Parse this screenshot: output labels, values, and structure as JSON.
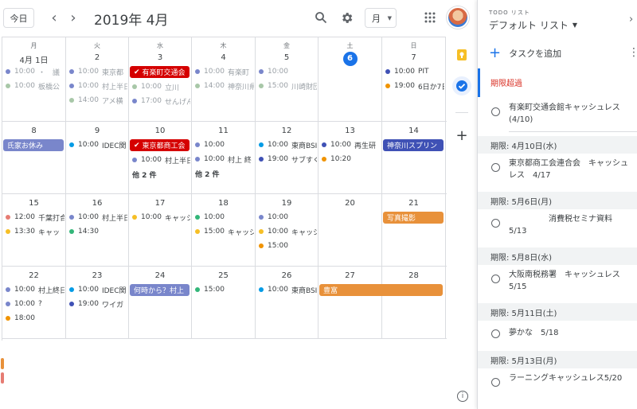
{
  "header": {
    "today_label": "今日",
    "prev_label": "‹",
    "next_label": "›",
    "month_title": "2019年 4月",
    "view_label": "月",
    "search_icon": "search-icon",
    "settings_icon": "gear-icon",
    "apps_icon": "apps-grid-icon"
  },
  "weekdays": [
    "月",
    "火",
    "水",
    "木",
    "金",
    "土",
    "日"
  ],
  "weeks": [
    {
      "days": [
        {
          "label": "4月 1日",
          "today": false,
          "events": [
            {
              "type": "dot",
              "time": "10:00",
              "title": "・　議",
              "color": "#7986cb",
              "past": true
            },
            {
              "type": "dot",
              "time": "10:00",
              "title": "板橋公",
              "color": "#a8c7a8",
              "past": true
            }
          ]
        },
        {
          "label": "2",
          "today": false,
          "events": [
            {
              "type": "dot",
              "time": "10:00",
              "title": "東京都",
              "color": "#7986cb",
              "past": true
            },
            {
              "type": "dot",
              "time": "10:00",
              "title": "村上半日",
              "color": "#7986cb",
              "past": true
            },
            {
              "type": "dot",
              "time": "14:00",
              "title": "アメ横",
              "color": "#a8c7a8",
              "past": true
            }
          ]
        },
        {
          "label": "3",
          "today": false,
          "events": [
            {
              "type": "bar",
              "title": "有楽町交通会",
              "color": "#d50000",
              "check": true
            },
            {
              "type": "dot",
              "time": "10:00",
              "title": "立川",
              "color": "#a8c7a8",
              "past": true
            },
            {
              "type": "dot",
              "time": "17:00",
              "title": "せんげん",
              "color": "#7986cb",
              "past": true
            }
          ]
        },
        {
          "label": "4",
          "today": false,
          "events": [
            {
              "type": "dot",
              "time": "10:00",
              "title": "有楽町",
              "color": "#7986cb",
              "past": true
            },
            {
              "type": "dot",
              "time": "14:00",
              "title": "神奈川県",
              "color": "#a8c7a8",
              "past": true
            }
          ]
        },
        {
          "label": "5",
          "today": false,
          "events": [
            {
              "type": "dot",
              "time": "10:00",
              "title": "",
              "color": "#7986cb",
              "past": true
            },
            {
              "type": "dot",
              "time": "15:00",
              "title": "川崎財団",
              "color": "#a8c7a8",
              "past": true
            }
          ]
        },
        {
          "label": "6",
          "today": true,
          "events": []
        },
        {
          "label": "7",
          "today": false,
          "events": [
            {
              "type": "dot",
              "time": "10:00",
              "title": "PIT",
              "color": "#3f51b5",
              "past": false
            },
            {
              "type": "dot",
              "time": "19:00",
              "title": "6日か7日",
              "color": "#f09300",
              "past": false
            }
          ]
        }
      ],
      "spans": []
    },
    {
      "days": [
        {
          "label": "8",
          "today": false,
          "events": [
            {
              "type": "bar",
              "title": "氏家お休み",
              "color": "#7986cb"
            }
          ]
        },
        {
          "label": "9",
          "today": false,
          "events": [
            {
              "type": "dot",
              "time": "10:00",
              "title": "IDEC関",
              "color": "#039be5",
              "past": false
            }
          ]
        },
        {
          "label": "10",
          "today": false,
          "events": [
            {
              "type": "bar",
              "title": "東京都商工会",
              "color": "#d50000",
              "check": true
            },
            {
              "type": "dot",
              "time": "10:00",
              "title": "村上半日",
              "color": "#7986cb",
              "past": false
            },
            {
              "type": "more",
              "title": "他 2 件"
            }
          ]
        },
        {
          "label": "11",
          "today": false,
          "events": [
            {
              "type": "dot",
              "time": "10:00",
              "title": "",
              "color": "#7986cb",
              "past": false
            },
            {
              "type": "dot",
              "time": "10:00",
              "title": "村上 終",
              "color": "#7986cb",
              "past": false
            },
            {
              "type": "more",
              "title": "他 2 件"
            }
          ]
        },
        {
          "label": "12",
          "today": false,
          "events": [
            {
              "type": "dot",
              "time": "10:00",
              "title": "東商BSI",
              "color": "#039be5",
              "past": false
            },
            {
              "type": "dot",
              "time": "19:00",
              "title": "サブすく",
              "color": "#3f51b5",
              "past": false
            }
          ]
        },
        {
          "label": "13",
          "today": false,
          "events": [
            {
              "type": "dot",
              "time": "10:00",
              "title": "再生研",
              "color": "#3f51b5",
              "past": false
            },
            {
              "type": "dot",
              "time": "10:20",
              "title": "",
              "color": "#f09300",
              "past": false
            }
          ]
        },
        {
          "label": "14",
          "today": false,
          "events": [
            {
              "type": "bar",
              "title": "神奈川スプリン",
              "color": "#3f51b5"
            }
          ]
        }
      ],
      "spans": []
    },
    {
      "days": [
        {
          "label": "15",
          "today": false,
          "events": [
            {
              "type": "dot",
              "time": "12:00",
              "title": "千葉打合",
              "color": "#e67c73",
              "past": false
            },
            {
              "type": "dot",
              "time": "13:30",
              "title": "キャッ",
              "color": "#f6bf26",
              "past": false
            }
          ]
        },
        {
          "label": "16",
          "today": false,
          "events": [
            {
              "type": "dot",
              "time": "10:00",
              "title": "村上半日",
              "color": "#7986cb",
              "past": false
            },
            {
              "type": "dot",
              "time": "14:30",
              "title": "",
              "color": "#33b679",
              "past": false
            }
          ]
        },
        {
          "label": "17",
          "today": false,
          "events": [
            {
              "type": "dot",
              "time": "10:00",
              "title": "キャッシ",
              "color": "#f6bf26",
              "past": false
            }
          ]
        },
        {
          "label": "18",
          "today": false,
          "events": [
            {
              "type": "dot",
              "time": "10:00",
              "title": "",
              "color": "#33b679",
              "past": false
            },
            {
              "type": "dot",
              "time": "15:00",
              "title": "キャッシ",
              "color": "#f6bf26",
              "past": false
            }
          ]
        },
        {
          "label": "19",
          "today": false,
          "events": [
            {
              "type": "dot",
              "time": "10:00",
              "title": "",
              "color": "#7986cb",
              "past": false
            },
            {
              "type": "dot",
              "time": "10:00",
              "title": "キャッシ",
              "color": "#f6bf26",
              "past": false
            },
            {
              "type": "dot",
              "time": "15:00",
              "title": "",
              "color": "#f09300",
              "past": false
            }
          ]
        },
        {
          "label": "20",
          "today": false,
          "events": []
        },
        {
          "label": "21",
          "today": false,
          "events": [
            {
              "type": "bar",
              "title": "写真撮影",
              "color": "#e8913a"
            }
          ]
        }
      ],
      "spans": []
    },
    {
      "days": [
        {
          "label": "22",
          "today": false,
          "events": [
            {
              "type": "dot",
              "time": "10:00",
              "title": "村上終日",
              "color": "#7986cb",
              "past": false
            },
            {
              "type": "dot",
              "time": "10:00",
              "title": "?",
              "color": "#7986cb",
              "past": false
            },
            {
              "type": "dot",
              "time": "18:00",
              "title": "",
              "color": "#f09300",
              "past": false
            }
          ]
        },
        {
          "label": "23",
          "today": false,
          "events": [
            {
              "type": "dot",
              "time": "10:00",
              "title": "IDEC関",
              "color": "#039be5",
              "past": false
            },
            {
              "type": "dot",
              "time": "19:00",
              "title": "ワイガ",
              "color": "#3f51b5",
              "past": false
            }
          ]
        },
        {
          "label": "24",
          "today": false,
          "events": [
            {
              "type": "bar",
              "title": "何時から？村上",
              "color": "#7986cb"
            }
          ]
        },
        {
          "label": "25",
          "today": false,
          "events": [
            {
              "type": "dot",
              "time": "15:00",
              "title": "",
              "color": "#33b679",
              "past": false
            }
          ]
        },
        {
          "label": "26",
          "today": false,
          "events": [
            {
              "type": "dot",
              "time": "10:00",
              "title": "東商BSI",
              "color": "#039be5",
              "past": false
            }
          ]
        },
        {
          "label": "27",
          "today": false,
          "events": []
        },
        {
          "label": "28",
          "today": false,
          "events": []
        }
      ],
      "spans": [
        {
          "title": "豊富",
          "color": "#e8913a"
        }
      ]
    }
  ],
  "tasks": {
    "supertitle": "TODO リスト",
    "list_name": "デフォルト リスト",
    "add_label": "タスクを追加",
    "overdue_label": "期限超過",
    "groups": [
      {
        "heading": "",
        "items": [
          "有楽町交通会館キャッシュレス　(4/10)"
        ]
      },
      {
        "heading": "期限: 4月10日(水)",
        "items": [
          "東京都商工会連合会　キャッシュレス　4/17"
        ]
      },
      {
        "heading": "期限: 5月6日(月)",
        "items": [
          "　　　　　消費税セミナ資料　5/13"
        ]
      },
      {
        "heading": "期限: 5月8日(水)",
        "items": [
          "大阪南税務署　キャッシュレス　5/15"
        ]
      },
      {
        "heading": "期限: 5月11日(土)",
        "items": [
          "夢かな　5/18"
        ]
      },
      {
        "heading": "期限: 5月13日(月)",
        "items": [
          "ラーニングキャッシュレス5/20"
        ]
      }
    ]
  },
  "colors": {
    "accent": "#1a73e8",
    "overdue": "#d93025",
    "keep_yellow": "#f6bf26"
  }
}
